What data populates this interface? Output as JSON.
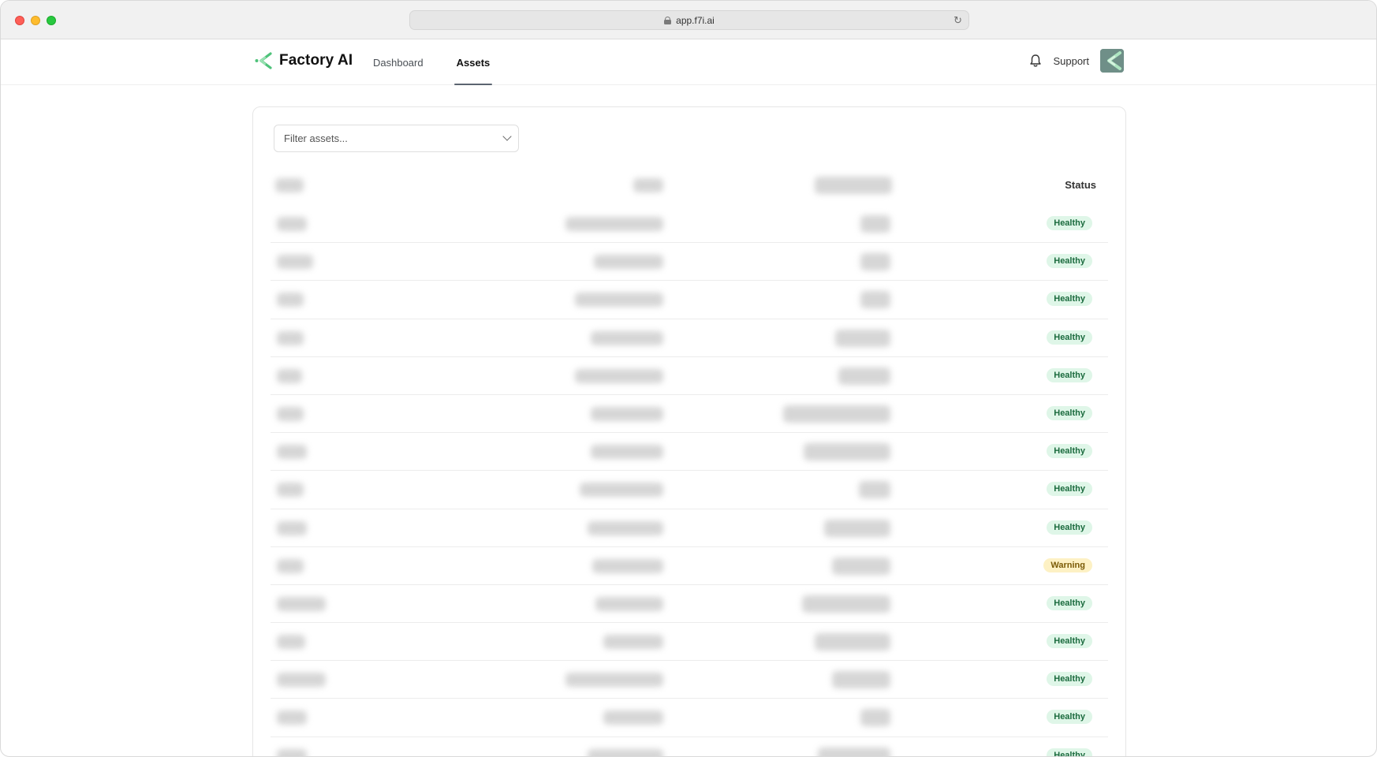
{
  "browser": {
    "url": "app.f7i.ai"
  },
  "header": {
    "brand": "Factory AI",
    "nav": [
      {
        "label": "Dashboard",
        "active": false
      },
      {
        "label": "Assets",
        "active": true
      }
    ],
    "support_label": "Support"
  },
  "assets": {
    "filter_placeholder": "Filter assets...",
    "columns": {
      "status": "Status"
    },
    "rows": [
      {
        "status": "Healthy",
        "tone": "ok"
      },
      {
        "status": "Healthy",
        "tone": "ok"
      },
      {
        "status": "Healthy",
        "tone": "ok"
      },
      {
        "status": "Healthy",
        "tone": "ok"
      },
      {
        "status": "Healthy",
        "tone": "ok"
      },
      {
        "status": "Healthy",
        "tone": "ok"
      },
      {
        "status": "Healthy",
        "tone": "ok"
      },
      {
        "status": "Healthy",
        "tone": "ok"
      },
      {
        "status": "Healthy",
        "tone": "ok"
      },
      {
        "status": "Warning",
        "tone": "warn"
      },
      {
        "status": "Healthy",
        "tone": "ok"
      },
      {
        "status": "Healthy",
        "tone": "ok"
      },
      {
        "status": "Healthy",
        "tone": "ok"
      },
      {
        "status": "Healthy",
        "tone": "ok"
      },
      {
        "status": "Healthy",
        "tone": "ok"
      }
    ]
  },
  "colors": {
    "healthy_bg": "#dff6e8",
    "healthy_text": "#1b6b3e",
    "warning_bg": "#fdf1c4",
    "warning_text": "#7a5a06",
    "brand_green": "#4ec27a"
  }
}
